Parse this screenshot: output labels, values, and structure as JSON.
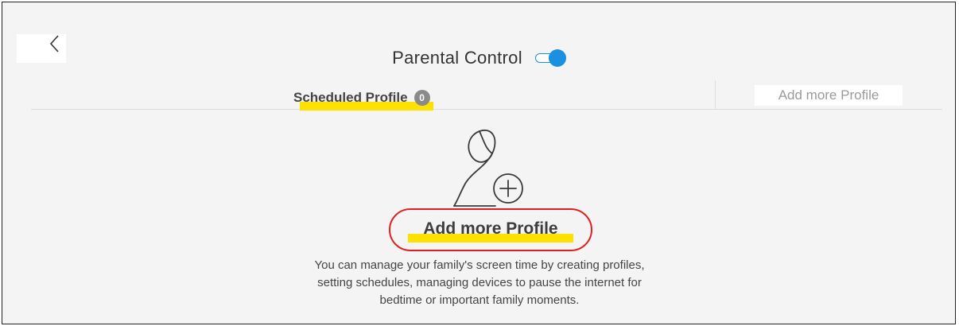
{
  "header": {
    "title": "Parental Control",
    "toggle_state": "on"
  },
  "tabs": {
    "scheduled_label": "Scheduled Profile",
    "scheduled_count": "0",
    "add_label": "Add more Profile"
  },
  "empty_state": {
    "icon": "add-profile-icon",
    "cta_label": "Add more Profile",
    "description_lines": [
      "You can manage your family's screen time by creating profiles,",
      "setting schedules, managing devices to pause the internet for",
      "bedtime or important family moments."
    ]
  },
  "colors": {
    "accent": "#1b8fe0",
    "highlight": "#ffe100",
    "annotation": "#e02020"
  }
}
